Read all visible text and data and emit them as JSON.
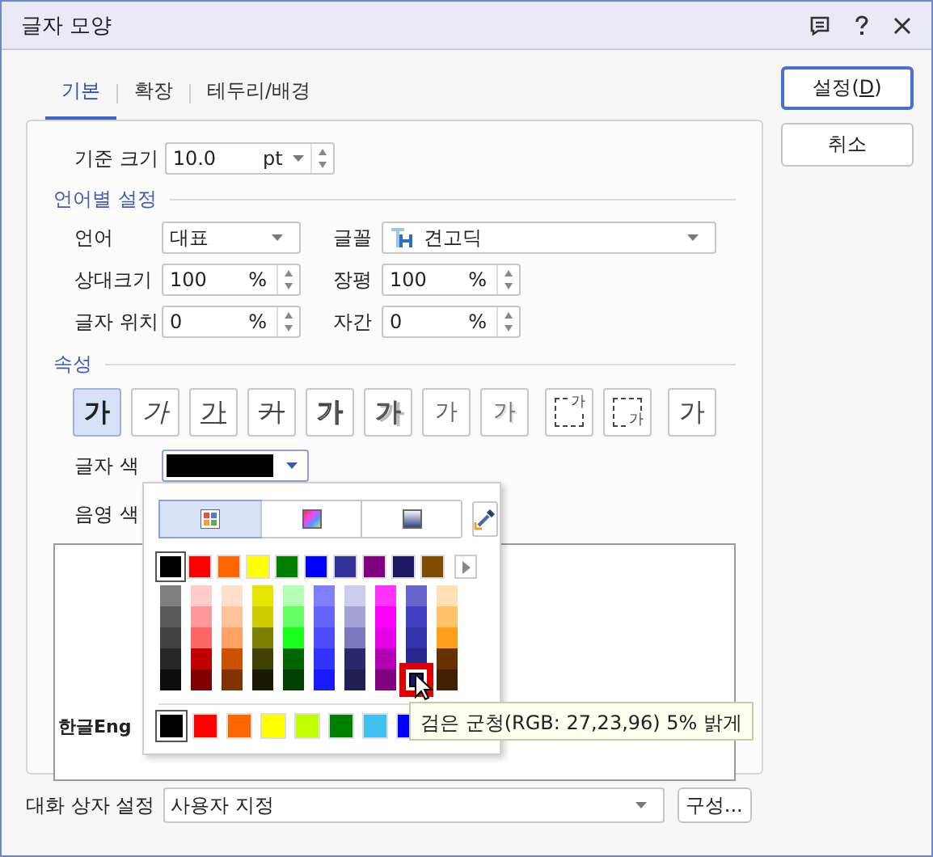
{
  "window": {
    "title": "글자 모양"
  },
  "tabs": [
    {
      "label": "기본",
      "selected": true
    },
    {
      "label": "확장",
      "selected": false
    },
    {
      "label": "테두리/배경",
      "selected": false
    }
  ],
  "buttons": [
    {
      "before": "설정(",
      "mnemonic": "D",
      "after": ")",
      "default": true
    },
    {
      "before": "취소",
      "default": false
    }
  ],
  "base_size": {
    "label": "기준 크기",
    "value": "10.0",
    "unit": "pt"
  },
  "language_section": {
    "title": "언어별 설정",
    "fields": [
      {
        "label": "언어",
        "kind": "dropdown",
        "value": "대표"
      },
      {
        "label": "글꼴",
        "kind": "font",
        "value": "견고딕"
      },
      {
        "label": "상대크기",
        "kind": "spinner",
        "value": "100",
        "unit": "%"
      },
      {
        "label": "장평",
        "kind": "spinner",
        "value": "100",
        "unit": "%"
      },
      {
        "label": "글자 위치",
        "kind": "spinner",
        "value": "0",
        "unit": "%"
      },
      {
        "label": "자간",
        "kind": "spinner",
        "value": "0",
        "unit": "%"
      }
    ]
  },
  "attributes": {
    "title": "속성",
    "buttons": [
      {
        "glyph": "가",
        "kind": "bold",
        "selected": true
      },
      {
        "glyph": "가",
        "kind": "italic",
        "selected": false
      },
      {
        "glyph": "가",
        "kind": "underline",
        "selected": false
      },
      {
        "glyph": "가",
        "kind": "strikeout",
        "selected": false
      },
      {
        "glyph": "가",
        "kind": "outline",
        "selected": false
      },
      {
        "glyph": "가",
        "kind": "shadow",
        "selected": false
      },
      {
        "glyph": "가",
        "kind": "emboss",
        "selected": false
      },
      {
        "glyph": "가",
        "kind": "engrave",
        "selected": false
      },
      {
        "glyph": "가",
        "kind": "superscript",
        "selected": false
      },
      {
        "glyph": "가",
        "kind": "subscript",
        "selected": false
      },
      {
        "glyph": "가",
        "kind": "normal",
        "selected": false
      }
    ]
  },
  "text_color": {
    "label": "글자 색",
    "color": "#000000"
  },
  "shade_color": {
    "label": "음영 색"
  },
  "preview": {
    "text": "한글Eng"
  },
  "palette": {
    "tabs": [
      {
        "kind": "grid",
        "selected": true
      },
      {
        "kind": "spectrum",
        "selected": false
      },
      {
        "kind": "gradient",
        "selected": false
      }
    ],
    "main": [
      {
        "color": "#000000",
        "selected": true
      },
      {
        "color": "#ff0000",
        "selected": false
      },
      {
        "color": "#ff6600",
        "selected": false
      },
      {
        "color": "#ffff00",
        "selected": false
      },
      {
        "color": "#008000",
        "selected": false
      },
      {
        "color": "#0000ff",
        "selected": false
      },
      {
        "color": "#333399",
        "selected": false
      },
      {
        "color": "#800080",
        "selected": false
      },
      {
        "color": "#1b1760",
        "selected": false
      },
      {
        "color": "#804c00",
        "selected": false
      }
    ],
    "shades": [
      {
        "colors": [
          {
            "color": "#808080",
            "selected": false
          },
          {
            "color": "#595959",
            "selected": false
          },
          {
            "color": "#404040",
            "selected": false
          },
          {
            "color": "#262626",
            "selected": false
          },
          {
            "color": "#0d0d0d",
            "selected": false
          }
        ]
      },
      {
        "colors": [
          {
            "color": "#ffcccc",
            "selected": false
          },
          {
            "color": "#ff9999",
            "selected": false
          },
          {
            "color": "#ff6666",
            "selected": false
          },
          {
            "color": "#c00000",
            "selected": false
          },
          {
            "color": "#800000",
            "selected": false
          }
        ]
      },
      {
        "colors": [
          {
            "color": "#ffe0cc",
            "selected": false
          },
          {
            "color": "#ffc299",
            "selected": false
          },
          {
            "color": "#ffa366",
            "selected": false
          },
          {
            "color": "#cc5200",
            "selected": false
          },
          {
            "color": "#803300",
            "selected": false
          }
        ]
      },
      {
        "colors": [
          {
            "color": "#e6e600",
            "selected": false
          },
          {
            "color": "#cccc00",
            "selected": false
          },
          {
            "color": "#808000",
            "selected": false
          },
          {
            "color": "#404000",
            "selected": false
          },
          {
            "color": "#1a1a00",
            "selected": false
          }
        ]
      },
      {
        "colors": [
          {
            "color": "#b3ffb3",
            "selected": false
          },
          {
            "color": "#66ff66",
            "selected": false
          },
          {
            "color": "#1aff1a",
            "selected": false
          },
          {
            "color": "#006600",
            "selected": false
          },
          {
            "color": "#004000",
            "selected": false
          }
        ]
      },
      {
        "colors": [
          {
            "color": "#8080ff",
            "selected": false
          },
          {
            "color": "#6666ff",
            "selected": false
          },
          {
            "color": "#4d4dff",
            "selected": false
          },
          {
            "color": "#3333ff",
            "selected": false
          },
          {
            "color": "#1a1aff",
            "selected": false
          }
        ]
      },
      {
        "colors": [
          {
            "color": "#ccccee",
            "selected": false
          },
          {
            "color": "#a3a3d6",
            "selected": false
          },
          {
            "color": "#7a7abf",
            "selected": false
          },
          {
            "color": "#29296b",
            "selected": false
          },
          {
            "color": "#1f1f52",
            "selected": false
          }
        ]
      },
      {
        "colors": [
          {
            "color": "#ff33ff",
            "selected": false
          },
          {
            "color": "#ff00ff",
            "selected": false
          },
          {
            "color": "#e600e6",
            "selected": false
          },
          {
            "color": "#b300b3",
            "selected": false
          },
          {
            "color": "#800080",
            "selected": false
          }
        ]
      },
      {
        "colors": [
          {
            "color": "#6666cc",
            "selected": false
          },
          {
            "color": "#4040c0",
            "selected": false
          },
          {
            "color": "#3333aa",
            "selected": false
          },
          {
            "color": "#2a2790",
            "selected": false
          },
          {
            "color": "#1b1760",
            "selected": true
          }
        ]
      },
      {
        "colors": [
          {
            "color": "#ffe0b3",
            "selected": false
          },
          {
            "color": "#ffc266",
            "selected": false
          },
          {
            "color": "#ff9f1a",
            "selected": false
          },
          {
            "color": "#663300",
            "selected": false
          },
          {
            "color": "#402000",
            "selected": false
          }
        ]
      }
    ],
    "recent": [
      {
        "color": "#000000",
        "selected": true
      },
      {
        "color": "#ff0000",
        "selected": false
      },
      {
        "color": "#ff6600",
        "selected": false
      },
      {
        "color": "#ffff00",
        "selected": false
      },
      {
        "color": "#bfff00",
        "selected": false
      },
      {
        "color": "#008000",
        "selected": false
      },
      {
        "color": "#40c0f0",
        "selected": false
      },
      {
        "color": "#0000ff",
        "selected": false
      }
    ],
    "tooltip": "검은 군청(RGB: 27,23,96) 5% 밝게"
  },
  "dialog_setting": {
    "label": "대화 상자 설정",
    "value": "사용자 지정",
    "button": "구성..."
  }
}
